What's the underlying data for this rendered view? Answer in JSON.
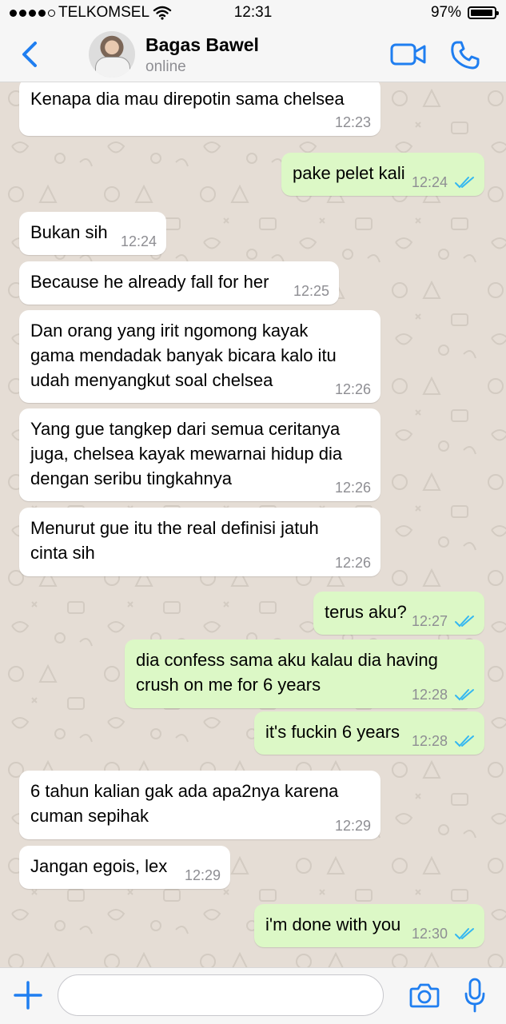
{
  "status_bar": {
    "carrier": "TELKOMSEL",
    "time": "12:31",
    "battery": "97%",
    "battery_level": 0.97
  },
  "header": {
    "contact_name": "Bagas Bawel",
    "contact_status": "online"
  },
  "colors": {
    "accent": "#1f7ef0",
    "outgoing_bubble": "#dcf8c6",
    "incoming_bubble": "#ffffff",
    "chat_background": "#e5ddd5",
    "read_ticks": "#34b7f1"
  },
  "messages": [
    {
      "direction": "in",
      "text": "Kenapa dia mau direpotin sama chelsea",
      "time": "12:23"
    },
    {
      "direction": "out",
      "text": "pake pelet kali",
      "time": "12:24",
      "status": "read"
    },
    {
      "direction": "in",
      "text": "Bukan sih",
      "time": "12:24"
    },
    {
      "direction": "in",
      "text": "Because he already fall for her",
      "time": "12:25"
    },
    {
      "direction": "in",
      "text": "Dan orang yang irit ngomong kayak gama mendadak banyak bicara kalo itu udah menyangkut soal chelsea",
      "time": "12:26"
    },
    {
      "direction": "in",
      "text": "Yang gue tangkep dari semua ceritanya juga, chelsea kayak mewarnai hidup dia dengan seribu tingkahnya",
      "time": "12:26"
    },
    {
      "direction": "in",
      "text": "Menurut gue itu the real definisi jatuh cinta sih",
      "time": "12:26"
    },
    {
      "direction": "out",
      "text": "terus aku?",
      "time": "12:27",
      "status": "read"
    },
    {
      "direction": "out",
      "text": "dia confess sama aku kalau dia having crush on me for 6 years",
      "time": "12:28",
      "status": "read"
    },
    {
      "direction": "out",
      "text": "it's fuckin 6 years",
      "time": "12:28",
      "status": "read"
    },
    {
      "direction": "in",
      "text": "6 tahun kalian gak ada apa2nya karena cuman sepihak",
      "time": "12:29"
    },
    {
      "direction": "in",
      "text": "Jangan egois, lex",
      "time": "12:29"
    },
    {
      "direction": "out",
      "text": "i'm done with you",
      "time": "12:30",
      "status": "read"
    }
  ],
  "input": {
    "placeholder": "",
    "value": ""
  },
  "icons": {
    "back": "chevron-left-icon",
    "video": "video-camera-icon",
    "call": "phone-icon",
    "add": "plus-icon",
    "sticker": "sticker-icon",
    "camera": "camera-icon",
    "mic": "microphone-icon",
    "wifi": "wifi-icon",
    "signal": "signal-dots-icon",
    "battery": "battery-icon"
  }
}
